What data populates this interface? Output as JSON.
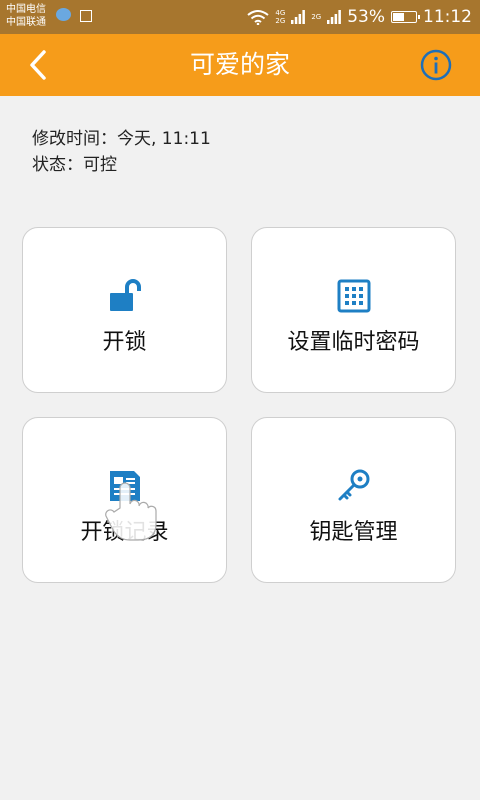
{
  "status_bar": {
    "carrier_1": "中国电信",
    "carrier_2": "中国联通",
    "net_primary_a": "4G",
    "net_primary_b": "2G",
    "net_secondary": "2G",
    "battery_percent": "53%",
    "battery_level": 0.53,
    "time": "11:12"
  },
  "app_bar": {
    "title": "可爱的家",
    "back_icon": "chevron-left-icon",
    "info_icon": "info-icon"
  },
  "meta": {
    "modified_label": "修改时间：",
    "modified_value": "今天, 11:11",
    "status_label": "状态：",
    "status_value": "可控"
  },
  "cards": [
    {
      "label": "开锁",
      "icon": "unlock-icon"
    },
    {
      "label": "设置临时密码",
      "icon": "keypad-icon"
    },
    {
      "label": "开锁记录",
      "icon": "record-icon"
    },
    {
      "label": "钥匙管理",
      "icon": "key-icon"
    }
  ],
  "colors": {
    "app_bar": "#f69c1a",
    "status_bar": "#a7762e",
    "icon_blue": "#1e7fc4",
    "background": "#f1f1f1"
  }
}
